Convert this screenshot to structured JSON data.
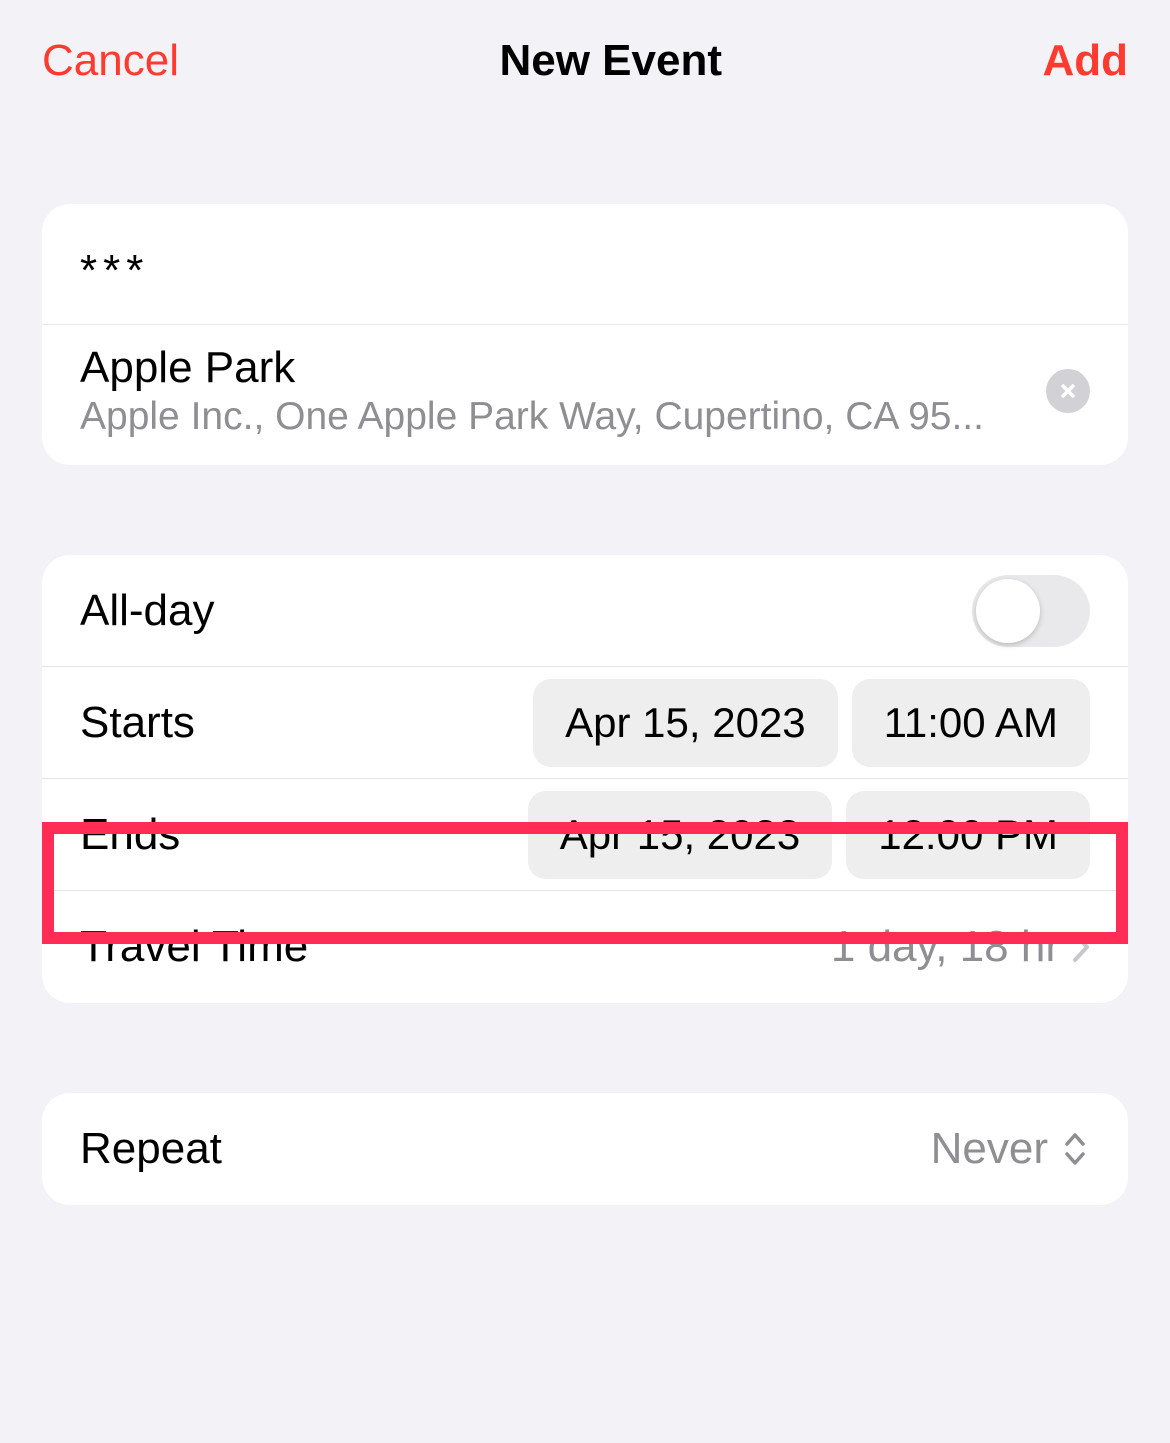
{
  "nav": {
    "cancel": "Cancel",
    "title": "New Event",
    "add": "Add"
  },
  "event": {
    "title_value": "***",
    "location_name": "Apple Park",
    "location_address": "Apple Inc., One Apple Park Way, Cupertino, CA 95..."
  },
  "datetime": {
    "all_day_label": "All-day",
    "all_day_on": false,
    "starts_label": "Starts",
    "starts_date": "Apr 15, 2023",
    "starts_time": "11:00 AM",
    "ends_label": "Ends",
    "ends_date": "Apr 15, 2023",
    "ends_time": "12:00 PM",
    "travel_label": "Travel Time",
    "travel_value": "1 day, 18 hr"
  },
  "repeat": {
    "label": "Repeat",
    "value": "Never"
  }
}
